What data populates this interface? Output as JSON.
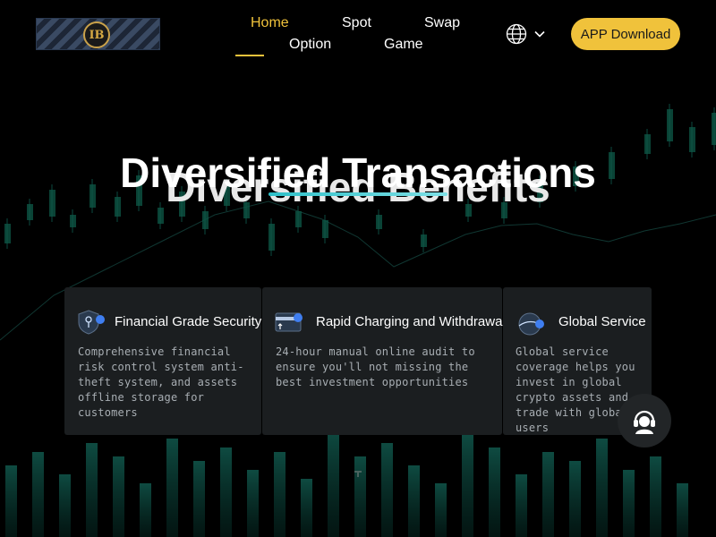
{
  "header": {
    "logo_text": "IB",
    "nav": [
      {
        "label": "Home",
        "active": true
      },
      {
        "label": "Spot",
        "active": false
      },
      {
        "label": "Swap",
        "active": false
      },
      {
        "label": "Option",
        "active": false
      },
      {
        "label": "Game",
        "active": false
      }
    ],
    "language_icon": "globe-icon",
    "dropdown_icon": "chevron-down-icon",
    "app_download_label": "APP Download"
  },
  "hero": {
    "title_primary": "Diversified Transactions",
    "title_secondary": "Diversified Benefits"
  },
  "features": [
    {
      "icon": "shield-icon",
      "title": "Financial Grade Security",
      "description": "Comprehensive financial risk control system anti-theft system, and assets offline storage for customers"
    },
    {
      "icon": "card-transfer-icon",
      "title": "Rapid Charging and Withdrawal",
      "description": "24-hour manual online audit to ensure you'll not missing the best investment opportunities"
    },
    {
      "icon": "globe-service-icon",
      "title": "Global Service",
      "description": "Global service coverage helps you invest in global crypto assets and trade with global users"
    }
  ],
  "support_icon": "customer-service-icon",
  "colors": {
    "accent": "#f0c23b",
    "background": "#000000",
    "card": "#1b1e20",
    "chart_green": "#0e5a48",
    "title_underline": "#2ec0c8"
  }
}
